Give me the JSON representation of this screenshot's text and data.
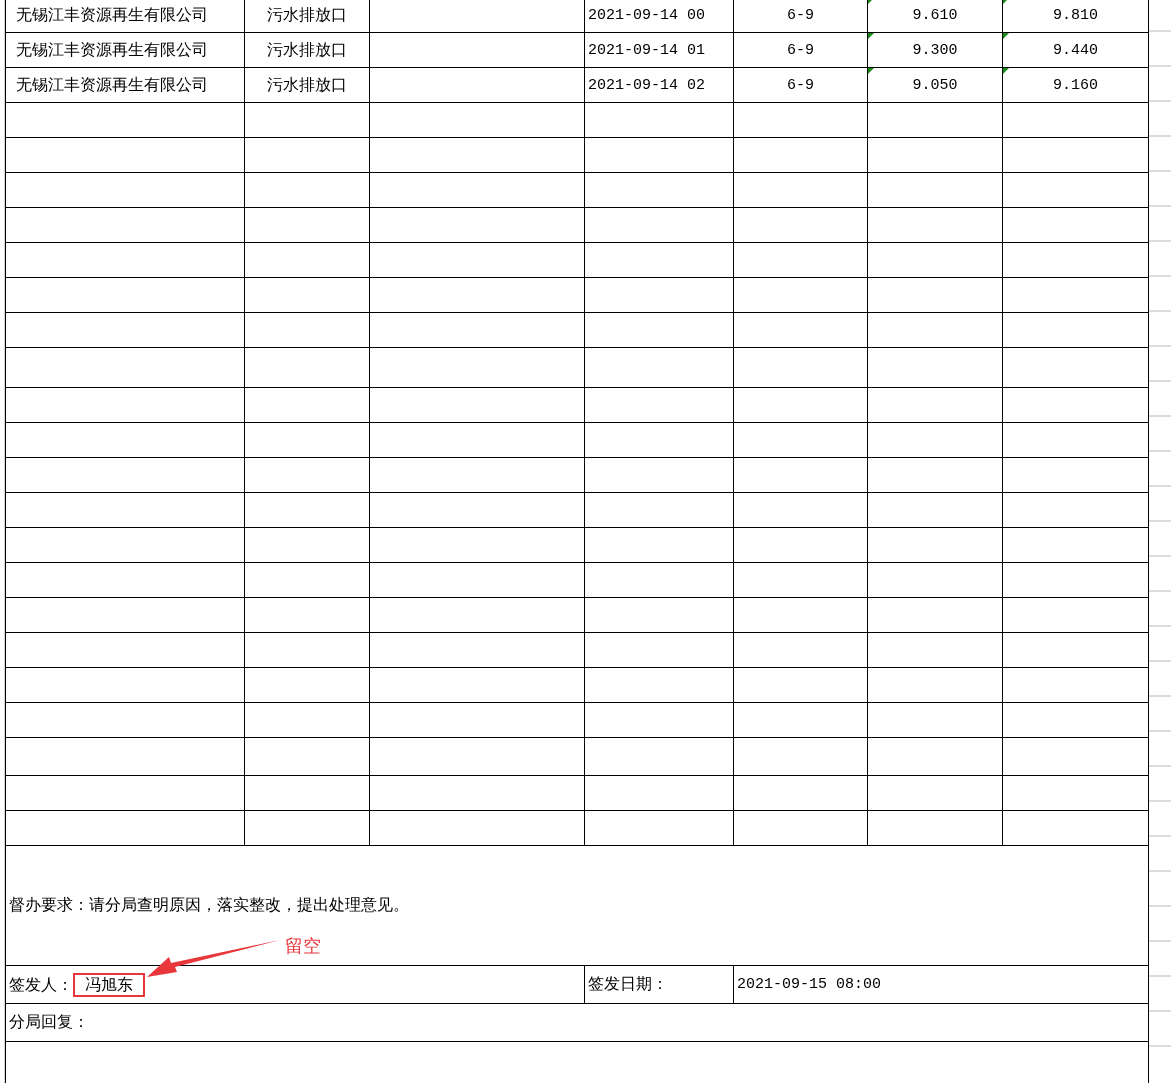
{
  "rows": [
    {
      "company": "无锡江丰资源再生有限公司",
      "outlet": "污水排放口",
      "time": "2021-09-14 00",
      "standard": "6-9",
      "value_1": "9.610",
      "value_1_flagged": true,
      "value_2": "9.810",
      "value_2_flagged": true
    },
    {
      "company": "无锡江丰资源再生有限公司",
      "outlet": "污水排放口",
      "time": "2021-09-14 01",
      "standard": "6-9",
      "value_1": "9.300",
      "value_1_flagged": true,
      "value_2": "9.440",
      "value_2_flagged": true
    },
    {
      "company": "无锡江丰资源再生有限公司",
      "outlet": "污水排放口",
      "time": "2021-09-14 02",
      "standard": "6-9",
      "value_1": "9.050",
      "value_1_flagged": true,
      "value_2": "9.160",
      "value_2_flagged": true
    }
  ],
  "requirement": "督办要求：请分局查明原因，落实整改，提出处理意见。",
  "signer": {
    "label": "签发人：",
    "name": "冯旭东",
    "highlighted": true
  },
  "issue_date": {
    "label": "签发日期：",
    "value": "2021-09-15 08:00"
  },
  "reply": {
    "label": "分局回复："
  },
  "annotation": {
    "text": "留空"
  }
}
